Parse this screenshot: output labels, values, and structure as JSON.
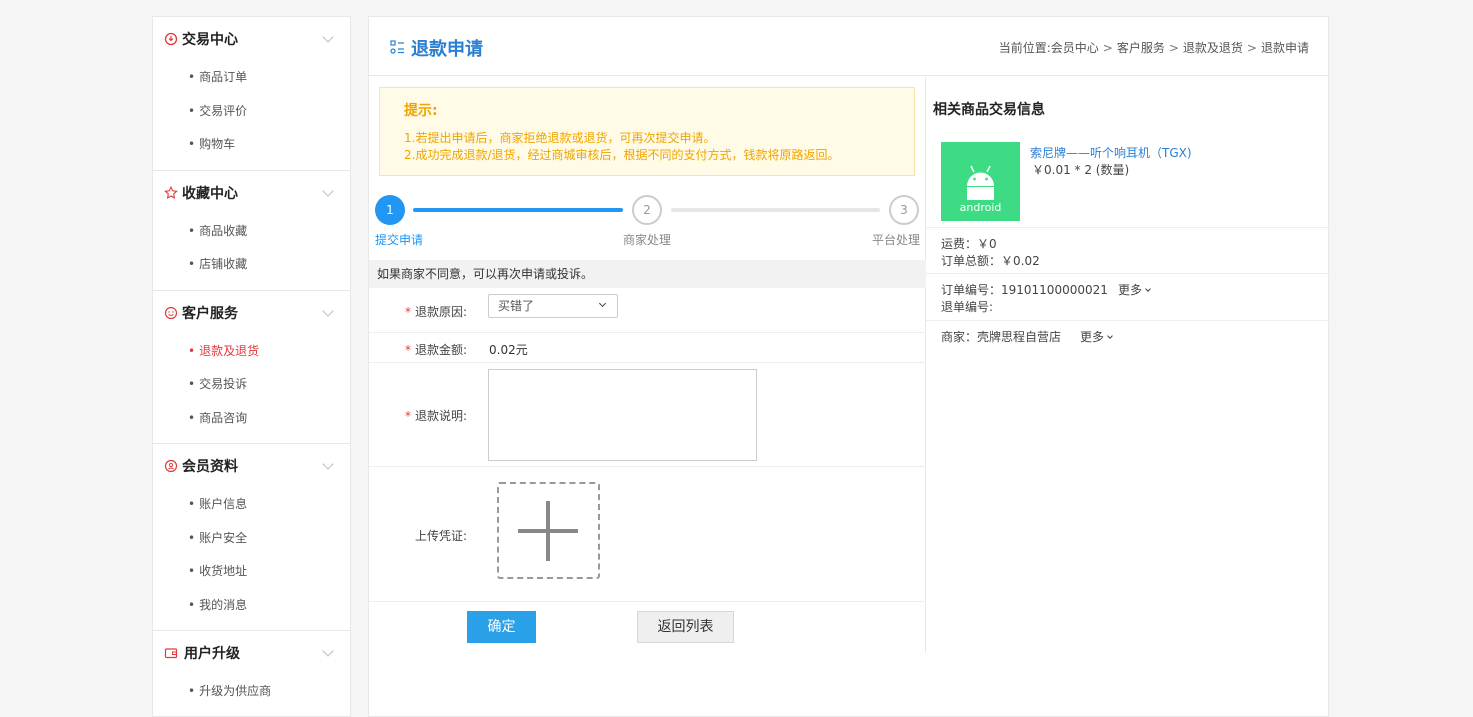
{
  "sidebar": {
    "sections": [
      {
        "title": "交易中心",
        "items": [
          "商品订单",
          "交易评价",
          "购物车"
        ]
      },
      {
        "title": "收藏中心",
        "items": [
          "商品收藏",
          "店铺收藏"
        ]
      },
      {
        "title": "客户服务",
        "items": [
          "退款及退货",
          "交易投诉",
          "商品咨询"
        ]
      },
      {
        "title": "会员资料",
        "items": [
          "账户信息",
          "账户安全",
          "收货地址",
          "我的消息"
        ]
      },
      {
        "title": "用户升级",
        "items": [
          "升级为供应商"
        ]
      }
    ],
    "active_item": "退款及退货"
  },
  "header": {
    "title": "退款申请",
    "breadcrumb": {
      "prefix": "当前位置:",
      "items": [
        "会员中心",
        "客户服务",
        "退款及退货",
        "退款申请"
      ],
      "separator": ">"
    }
  },
  "tip": {
    "title": "提示:",
    "lines": [
      "1.若提出申请后，商家拒绝退款或退货，可再次提交申请。",
      "2.成功完成退款/退货，经过商城审核后，根据不同的支付方式，钱款将原路返回。"
    ]
  },
  "steps": [
    {
      "num": "1",
      "label": "提交申请"
    },
    {
      "num": "2",
      "label": "商家处理"
    },
    {
      "num": "3",
      "label": "平台处理"
    }
  ],
  "form": {
    "note": "如果商家不同意，可以再次申请或投诉。",
    "required_mark": "*",
    "reason_label": "退款原因:",
    "reason_value": "买错了",
    "amount_label": "退款金额:",
    "amount_value": "0.02元",
    "desc_label": "退款说明:",
    "upload_label": "上传凭证:",
    "ok_label": "确定",
    "back_label": "返回列表"
  },
  "related": {
    "title": "相关商品交易信息",
    "product_name": "索尼牌——听个响耳机（TGX)",
    "product_price": "￥0.01 * 2 (数量)",
    "image_text": "android",
    "shipping": "运费：￥0",
    "total": "订单总额：￥0.02",
    "order_no": "订单编号：19101100000021",
    "refund_no": "退单编号:",
    "merchant": "商家：壳牌思程自营店",
    "more_label": "更多"
  },
  "colors": {
    "accent": "#2196f3",
    "active_red": "#e4393c",
    "tip_orange": "#f0a400",
    "android_green": "#3ddc84"
  }
}
